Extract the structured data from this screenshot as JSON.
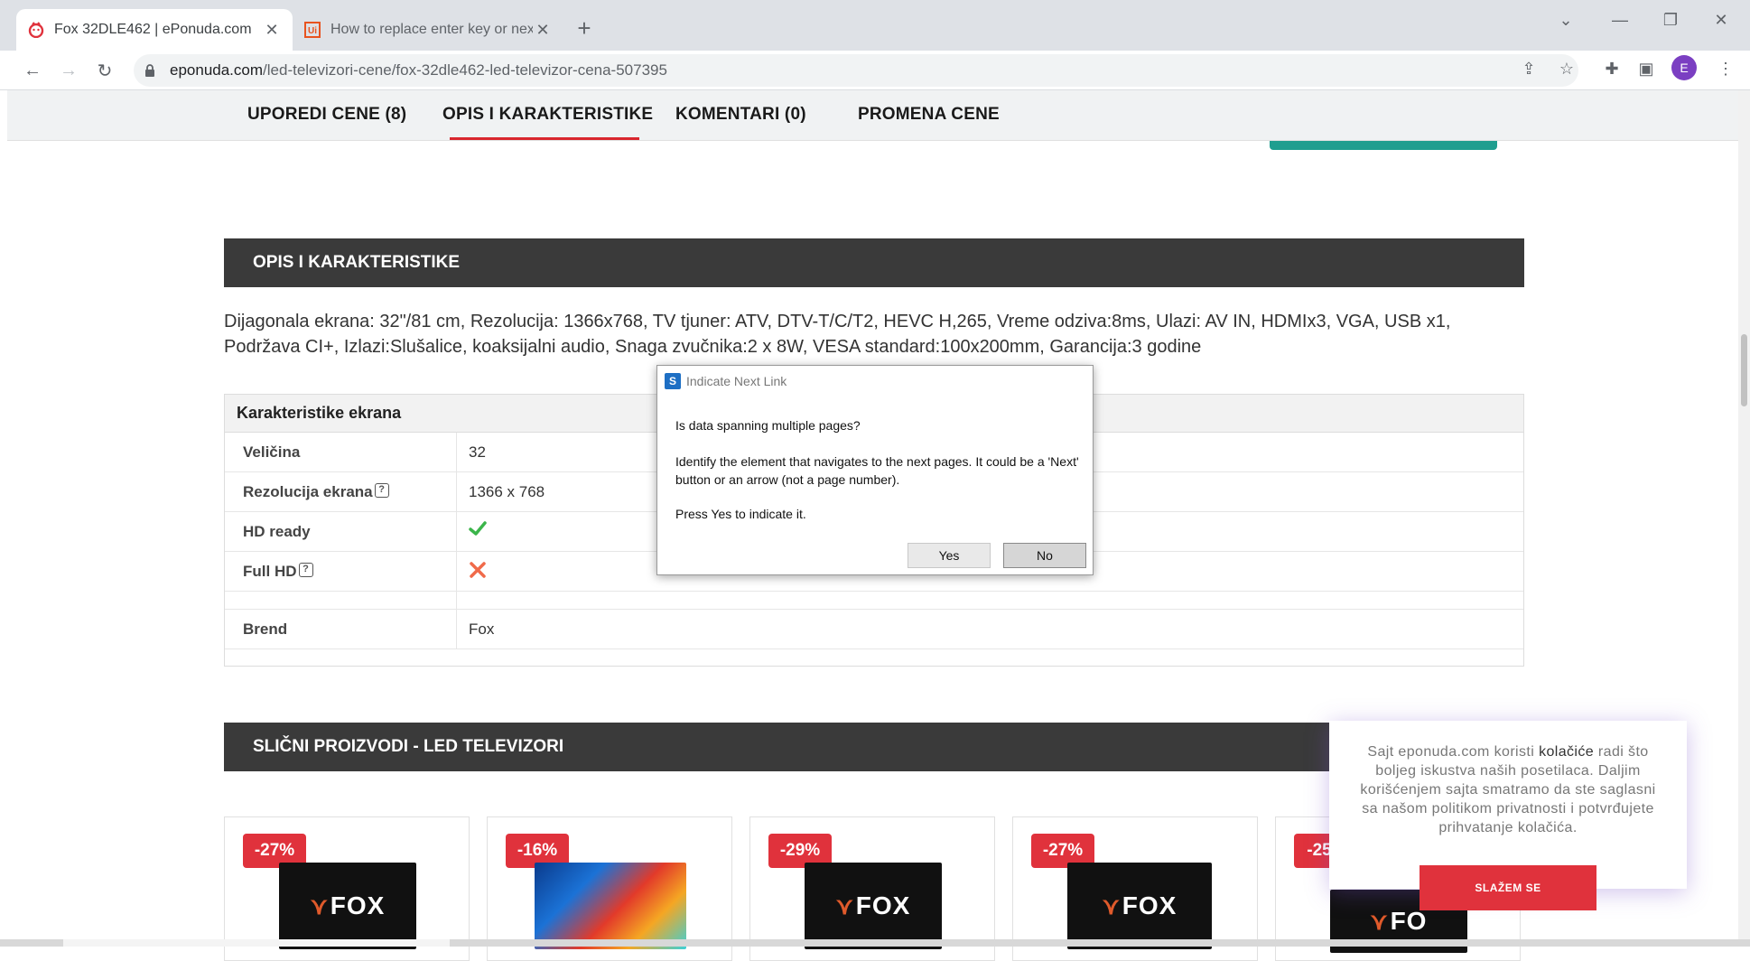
{
  "browser": {
    "tabs": [
      {
        "title": "Fox 32DLE462 | ePonuda.com",
        "favicon": "eponuda-icon",
        "active": true
      },
      {
        "title": "How to replace enter key or next",
        "favicon": "uipath-icon",
        "active": false
      }
    ],
    "url_host": "eponuda.com",
    "url_path": "/led-televizori-cene/fox-32dle462-led-televizor-cena-507395",
    "profile_initial": "E"
  },
  "page": {
    "nav_tabs": [
      "UPOREDI CENE (8)",
      "OPIS I KARAKTERISTIKE",
      "KOMENTARI (0)",
      "PROMENA CENE"
    ],
    "section_title": "OPIS I KARAKTERISTIKE",
    "description": "Dijagonala ekrana: 32\"/81 cm, Rezolucija: 1366x768, TV tjuner: ATV, DTV-T/C/T2, HEVC H,265, Vreme odziva:8ms, Ulazi: AV IN, HDMIx3, VGA, USB x1, Podržava CI+, Izlazi:Slušalice, koaksijalni audio, Snaga zvučnika:2 x 8W, VESA standard:100x200mm, Garancija:3 godine",
    "spec_table": {
      "heading": "Karakteristike ekrana",
      "rows": [
        {
          "key": "Veličina",
          "value": "32"
        },
        {
          "key": "Rezolucija ekrana",
          "value": "1366 x 768"
        },
        {
          "key": "HD ready",
          "value": "yes"
        },
        {
          "key": "Full HD",
          "value": "no"
        },
        {
          "key": "Brend",
          "value": "Fox"
        }
      ]
    },
    "similar_title": "SLIČNI PROIZVODI - LED TELEVIZORI",
    "product_cards": [
      {
        "discount": "-27%",
        "brand_logo": "FOX"
      },
      {
        "discount": "-16%",
        "brand_logo": ""
      },
      {
        "discount": "-29%",
        "brand_logo": "FOX"
      },
      {
        "discount": "-27%",
        "brand_logo": "FOX"
      },
      {
        "discount": "-25",
        "brand_logo": "FO"
      }
    ]
  },
  "dialog": {
    "title": "Indicate Next Link",
    "question": "Is data spanning multiple pages?",
    "body": "Identify the element that navigates to the next pages. It could be a 'Next' button or an arrow (not a page number).",
    "instruction": "Press Yes to indicate it.",
    "yes_label": "Yes",
    "no_label": "No"
  },
  "cookie": {
    "text_before": "Sajt eponuda.com koristi ",
    "text_link": "kolačiće",
    "text_after": " radi što boljeg iskustva naših posetilaca. Daljim korišćenjem sajta smatramo da ste saglasni sa našom politikom privatnosti i potvrđujete prihvatanje kolačića.",
    "accept_label": "SLAŽEM SE"
  },
  "colors": {
    "accent_red": "#e0323c",
    "dark_bar": "#3a3a3a",
    "teal": "#1f9e8f"
  }
}
